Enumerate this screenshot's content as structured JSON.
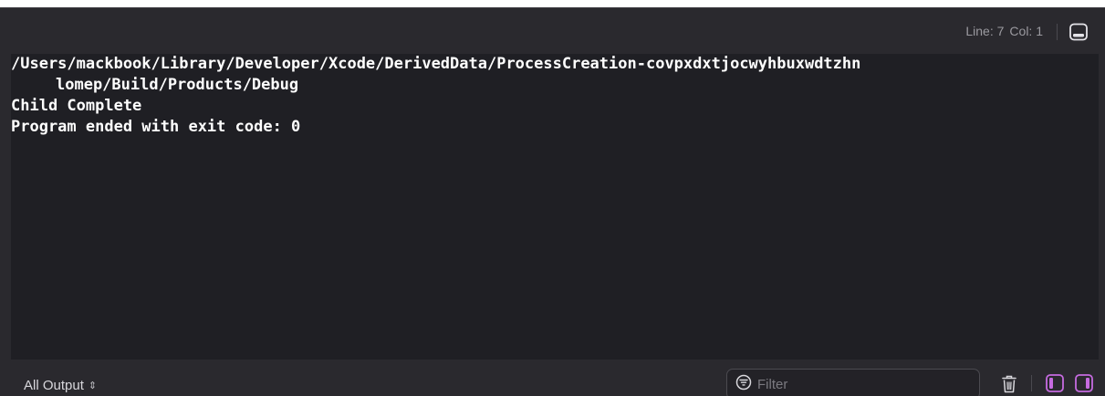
{
  "status": {
    "line_label": "Line: 7",
    "col_label": "Col: 1"
  },
  "console": {
    "lines": [
      "/Users/mackbook/Library/Developer/Xcode/DerivedData/ProcessCreation-covpxdxtjocwyhbuxwdtzhn",
      "lomep/Build/Products/Debug",
      "Child Complete",
      "Program ended with exit code: 0"
    ]
  },
  "bottom": {
    "output_selector": "All Output",
    "filter_placeholder": "Filter"
  },
  "colors": {
    "background": "#2a292e",
    "console_bg": "#1f1f24",
    "text": "#ffffff",
    "accent": "#c66be0"
  },
  "icons": {
    "panel_toggle": "bottom-panel-icon",
    "filter": "filter-icon",
    "trash": "trash-icon",
    "left_view": "left-pane-icon",
    "right_view": "right-pane-icon"
  }
}
